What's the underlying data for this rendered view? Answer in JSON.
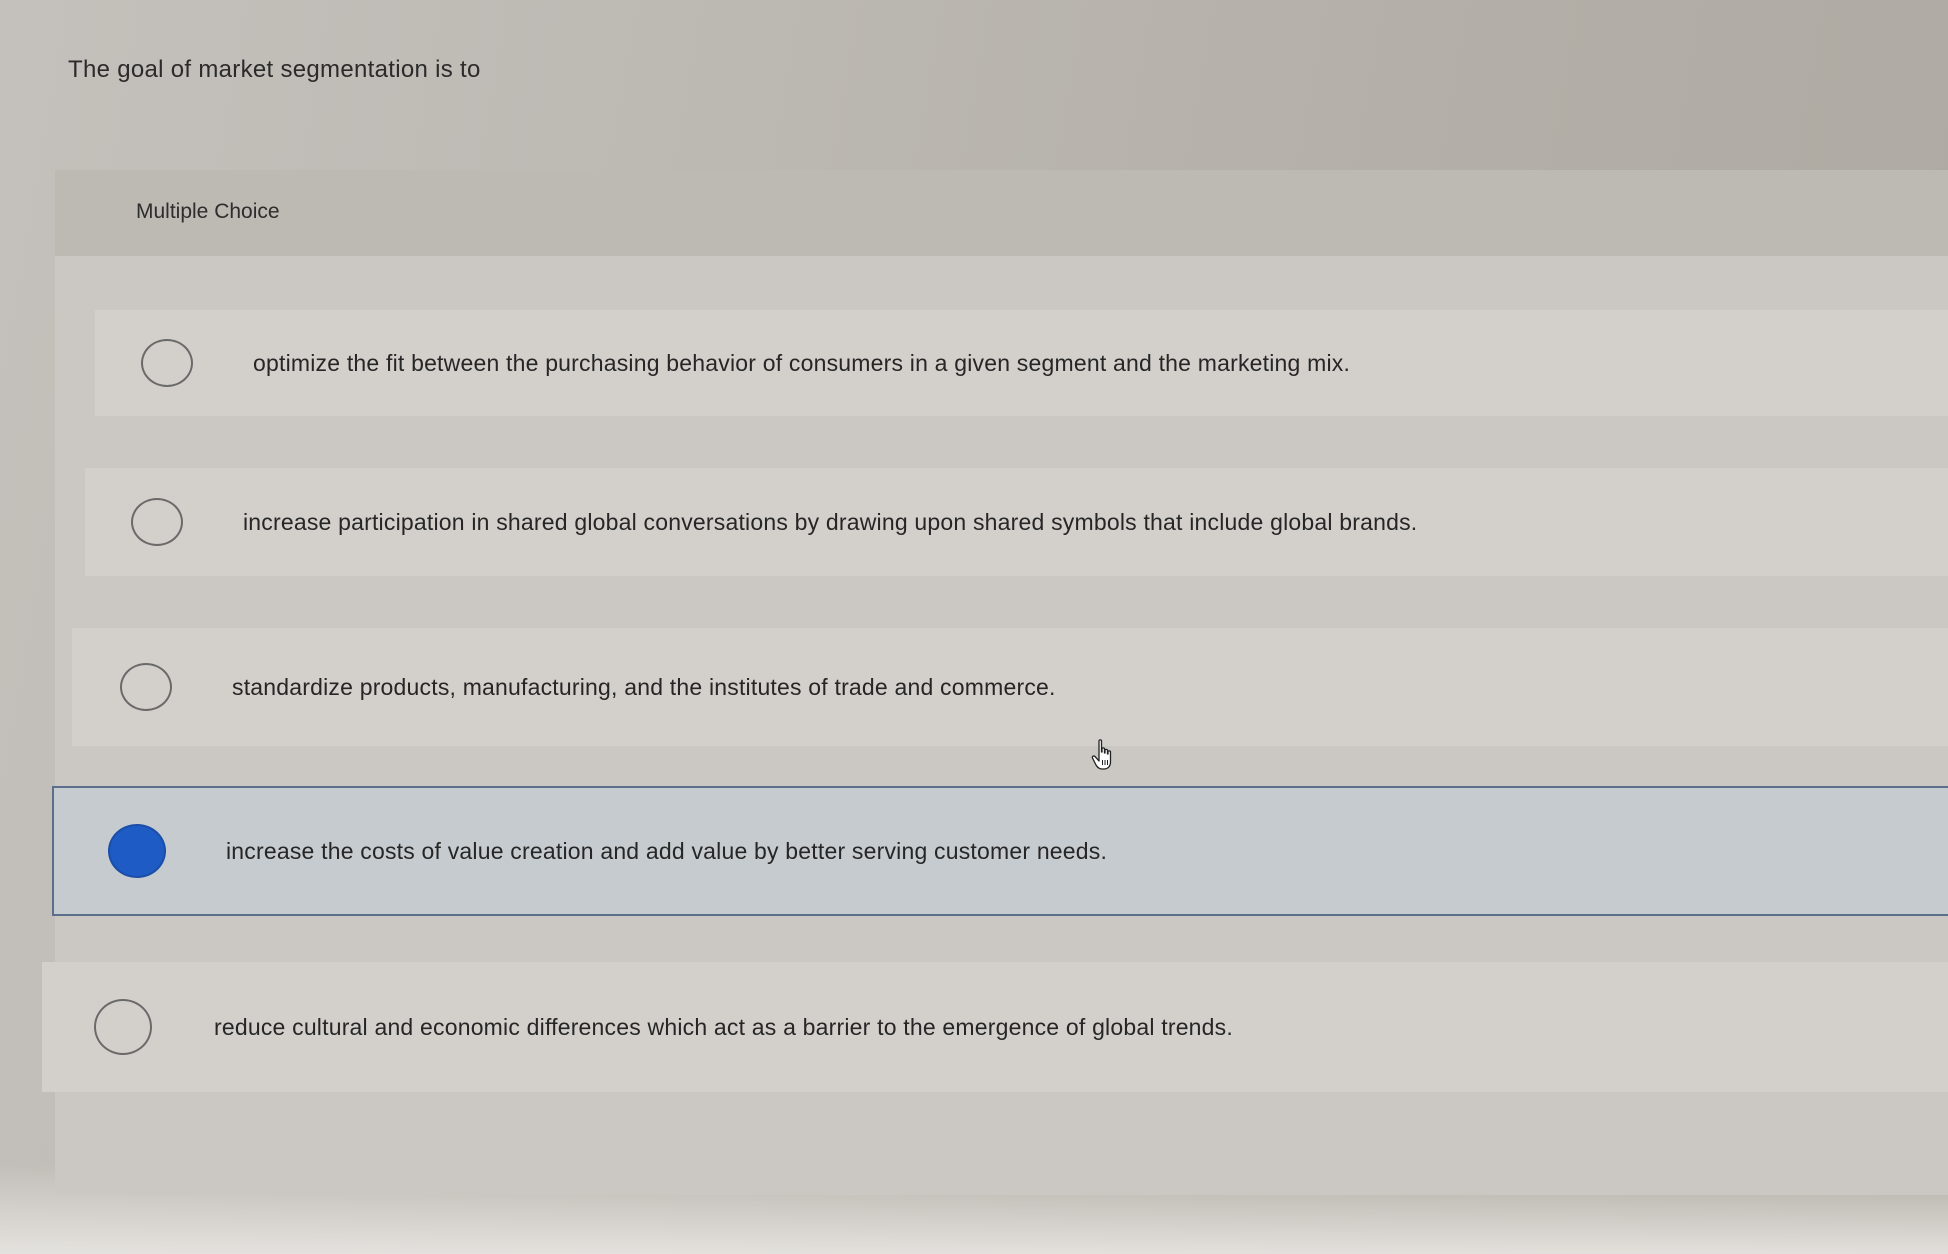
{
  "question": {
    "text": "The goal of market segmentation is to"
  },
  "panel": {
    "title": "Multiple Choice"
  },
  "options": [
    {
      "label": "optimize the fit between the purchasing behavior of consumers in a given segment and the marketing mix.",
      "selected": false
    },
    {
      "label": "increase participation in shared global conversations by drawing upon shared symbols that include global brands.",
      "selected": false
    },
    {
      "label": "standardize products, manufacturing, and the institutes of trade and commerce.",
      "selected": false
    },
    {
      "label": "increase the costs of value creation and add value by better serving customer needs.",
      "selected": true
    },
    {
      "label": "reduce cultural and economic differences which act as a barrier to the emergence of global trends.",
      "selected": false
    }
  ],
  "colors": {
    "selected_radio": "#1f5bc4",
    "selected_border": "#5b6f8c"
  },
  "icons": {
    "cursor": "hand-pointer-icon"
  }
}
